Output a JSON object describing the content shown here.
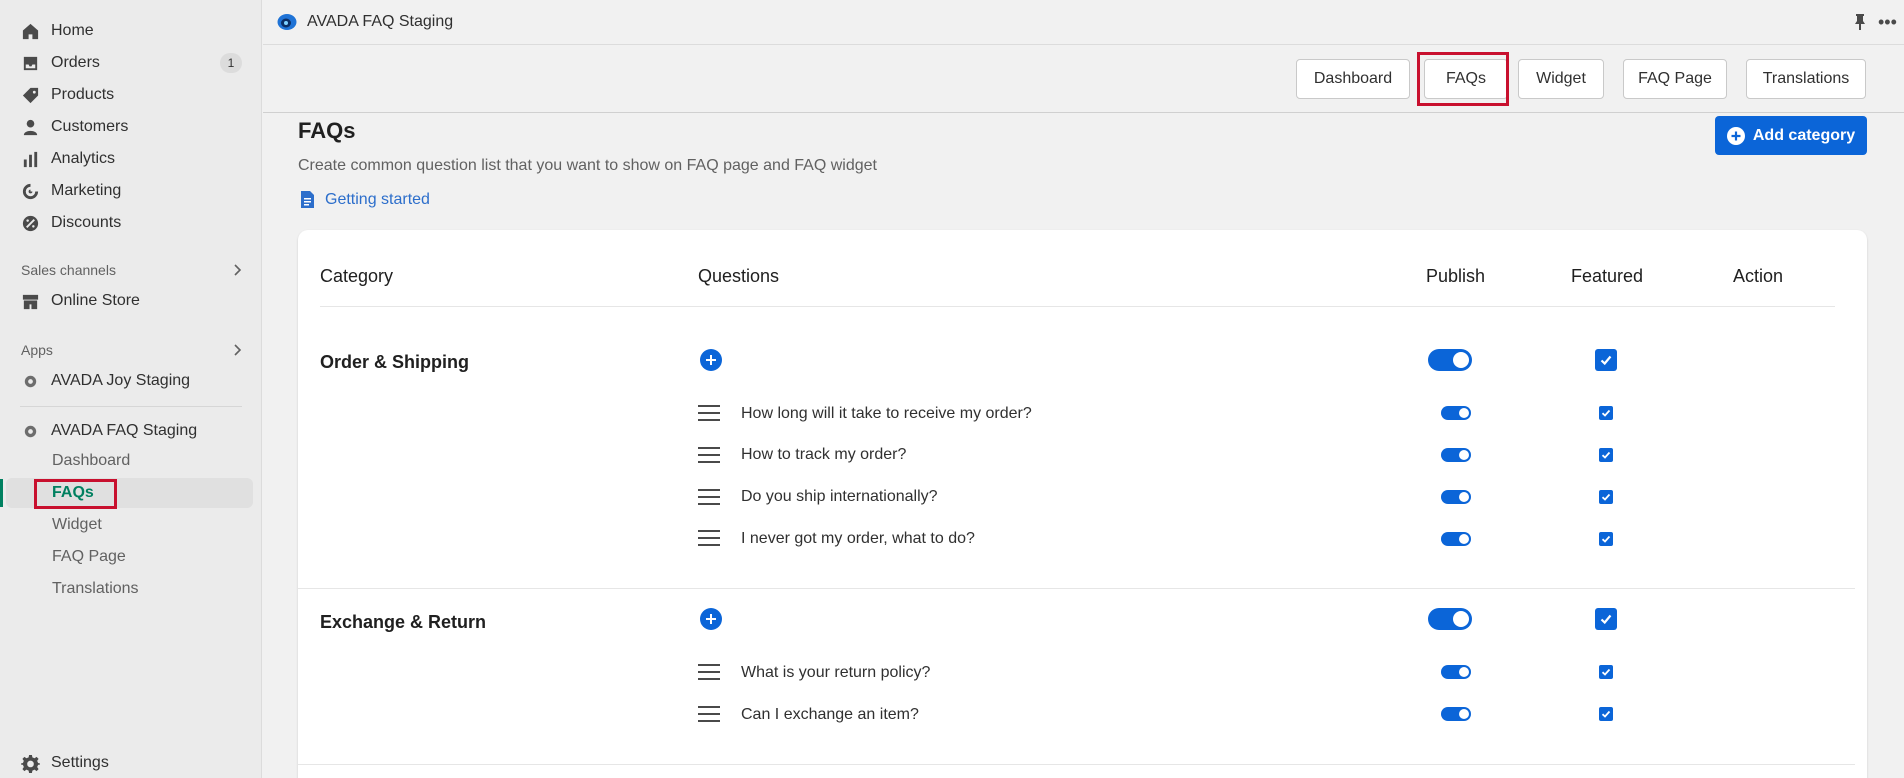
{
  "sidebar": {
    "items": [
      {
        "label": "Home",
        "icon": "home-icon"
      },
      {
        "label": "Orders",
        "icon": "orders-icon",
        "badge": "1"
      },
      {
        "label": "Products",
        "icon": "tag-icon"
      },
      {
        "label": "Customers",
        "icon": "person-icon"
      },
      {
        "label": "Analytics",
        "icon": "bar-chart-icon"
      },
      {
        "label": "Marketing",
        "icon": "target-icon"
      },
      {
        "label": "Discounts",
        "icon": "discount-icon"
      }
    ],
    "sales_channels_label": "Sales channels",
    "online_store_label": "Online Store",
    "apps_label": "Apps",
    "joy_app_label": "AVADA Joy Staging",
    "faq_app_label": "AVADA FAQ Staging",
    "faq_sub_items": [
      {
        "label": "Dashboard"
      },
      {
        "label": "FAQs"
      },
      {
        "label": "Widget"
      },
      {
        "label": "FAQ Page"
      },
      {
        "label": "Translations"
      }
    ],
    "settings_label": "Settings"
  },
  "topbar": {
    "app_title": "AVADA FAQ Staging"
  },
  "tabs": [
    {
      "label": "Dashboard"
    },
    {
      "label": "FAQs"
    },
    {
      "label": "Widget"
    },
    {
      "label": "FAQ Page"
    },
    {
      "label": "Translations"
    }
  ],
  "main": {
    "title": "FAQs",
    "description": "Create common question list that you want to show on FAQ page and FAQ widget",
    "getting_started": "Getting started",
    "add_category": "Add category"
  },
  "table": {
    "headers": {
      "category": "Category",
      "questions": "Questions",
      "publish": "Publish",
      "featured": "Featured",
      "action": "Action"
    },
    "categories": [
      {
        "name": "Order & Shipping",
        "published": true,
        "featured": true,
        "questions": [
          {
            "text": "How long will it take to receive my order?",
            "published": true,
            "featured": true
          },
          {
            "text": "How to track my order?",
            "published": true,
            "featured": true
          },
          {
            "text": "Do you ship internationally?",
            "published": true,
            "featured": true
          },
          {
            "text": "I never got my order, what to do?",
            "published": true,
            "featured": true
          }
        ]
      },
      {
        "name": "Exchange & Return",
        "published": true,
        "featured": true,
        "questions": [
          {
            "text": "What is your return policy?",
            "published": true,
            "featured": true
          },
          {
            "text": "Can I exchange an item?",
            "published": true,
            "featured": true
          }
        ]
      }
    ]
  },
  "colors": {
    "accent": "#0b65d8",
    "highlight_box": "#c8102e",
    "active_indicator": "#008060"
  }
}
